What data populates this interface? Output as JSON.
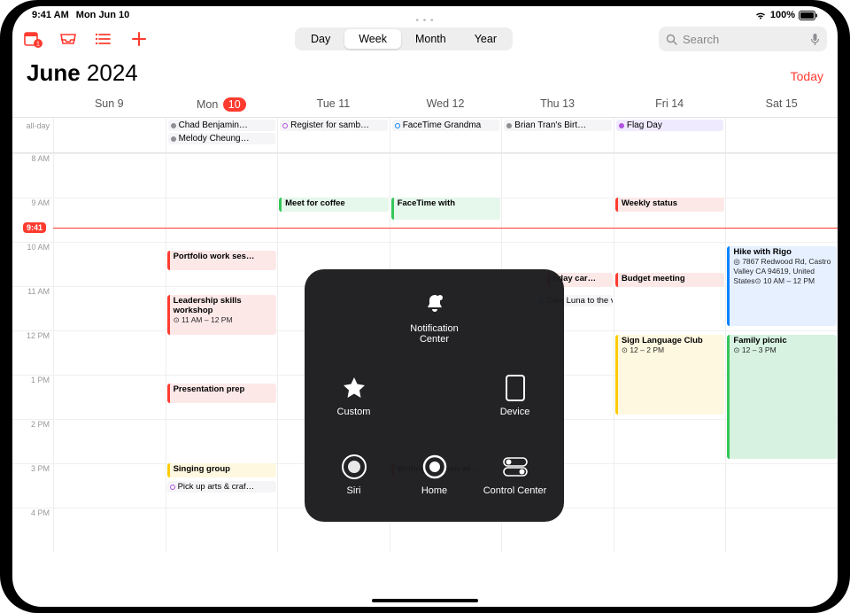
{
  "status": {
    "time": "9:41 AM",
    "date": "Mon Jun 10",
    "battery": "100%"
  },
  "toolbar": {
    "badge": "1"
  },
  "tabs": {
    "day": "Day",
    "week": "Week",
    "month": "Month",
    "year": "Year"
  },
  "search": {
    "placeholder": "Search"
  },
  "title": {
    "month": "June",
    "year": "2024",
    "today": "Today"
  },
  "days": {
    "allday": "all-day",
    "sun": "Sun 9",
    "mon_pre": "Mon",
    "mon_num": "10",
    "tue": "Tue 11",
    "wed": "Wed 12",
    "thu": "Thu 13",
    "fri": "Fri 14",
    "sat": "Sat 15"
  },
  "hours": {
    "h8": "8 AM",
    "h9": "9 AM",
    "h10": "10 AM",
    "h11": "11 AM",
    "h12": "12 PM",
    "h1": "1 PM",
    "h2": "2 PM",
    "h3": "3 PM",
    "h4": "4 PM"
  },
  "now": "9:41",
  "allday_ev": {
    "mon1": "Chad Benjamin…",
    "mon2": "Melody Cheung…",
    "tue1": "Register for samb…",
    "wed1": "FaceTime Grandma",
    "thu1": "Brian Tran's Birt…",
    "fri1": "Flag Day"
  },
  "events": {
    "mon_portfolio": "Portfolio work ses…",
    "mon_leadership_t": "Leadership skills workshop",
    "mon_leadership_s": "⊙ 11 AM – 12 PM",
    "mon_present": "Presentation prep",
    "mon_singing": "Singing group",
    "mon_pickup": "Pick up arts & craf…",
    "tue_coffee": "Meet for coffee",
    "wed_ft": "FaceTime with",
    "wed_writing": "Writing session wi…",
    "thu_bday": "hday car…",
    "thu_luna": "Take Luna to the vet",
    "fri_weekly": "Weekly status",
    "fri_budget": "Budget meeting",
    "fri_sign_t": "Sign Language Club",
    "fri_sign_s": "⊙ 12 – 2 PM",
    "sat_hike_t": "Hike with Rigo",
    "sat_hike_loc": "◎ 7867 Redwood Rd, Castro Valley CA 94619, United States",
    "sat_hike_time": "⊙ 10 AM – 12 PM",
    "sat_picnic_t": "Family picnic",
    "sat_picnic_s": "⊙ 12 – 3 PM"
  },
  "atouch": {
    "notif": "Notification Center",
    "custom": "Custom",
    "device": "Device",
    "siri": "Siri",
    "control": "Control Center",
    "home": "Home"
  }
}
